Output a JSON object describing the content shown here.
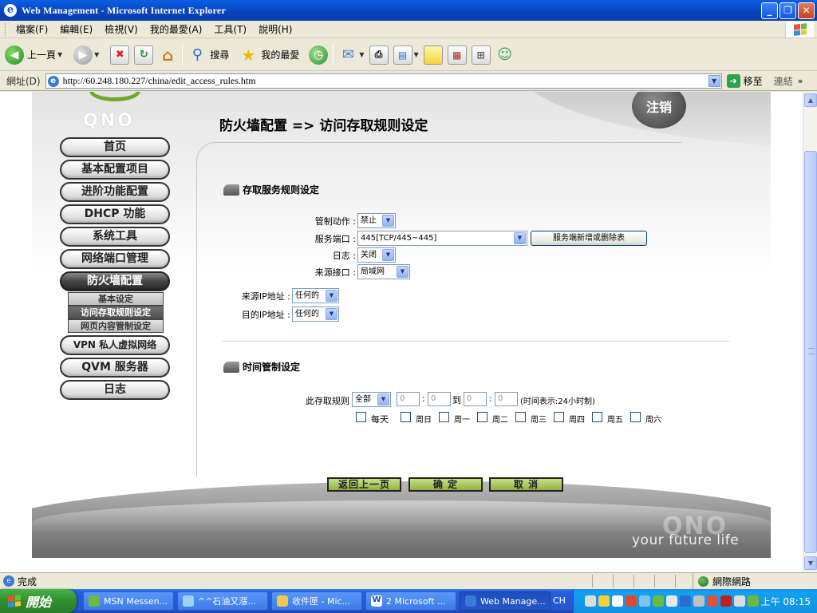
{
  "window": {
    "title": "Web Management - Microsoft Internet Explorer",
    "min_label": "_",
    "max_label": "❐",
    "close_label": "✕"
  },
  "menubar": {
    "items": [
      "檔案(F)",
      "編輯(E)",
      "檢視(V)",
      "我的最愛(A)",
      "工具(T)",
      "說明(H)"
    ]
  },
  "toolbar": {
    "back_label": "上一頁",
    "search_label": "搜尋",
    "favorites_label": "我的最愛"
  },
  "addressbar": {
    "label": "網址(D)",
    "url": "http://60.248.180.227/china/edit_access_rules.htm",
    "go_label": "移至",
    "links_label": "連結"
  },
  "page": {
    "logo": "QNO",
    "logout": "注销",
    "title": "防火墙配置 => 访问存取规则设定",
    "footer_brand": "your future life",
    "footer_logo": "QNO"
  },
  "nav": {
    "items": [
      "首页",
      "基本配置项目",
      "进阶功能配置",
      "DHCP 功能",
      "系统工具",
      "网络端口管理",
      "防火墙配置",
      "VPN 私人虚拟网络",
      "QVM 服务器",
      "日志"
    ],
    "active_index": 6,
    "sub_items": [
      "基本设定",
      "访问存取规则设定",
      "网页内容管制设定"
    ],
    "sub_active_index": 1
  },
  "access_section": {
    "title": "存取服务规则设定",
    "action_label": "管制动作 :",
    "action_value": "禁止",
    "service_label": "服务端口 :",
    "service_value": "445[TCP/445~445]",
    "service_button": "服务端新增或删除表",
    "log_label": "日志 :",
    "log_value": "关闭",
    "source_if_label": "来源接口 :",
    "source_if_value": "局域网",
    "source_ip_label": "来源IP地址 :",
    "source_ip_value": "任何的",
    "dest_ip_label": "目的IP地址 :",
    "dest_ip_value": "任何的"
  },
  "time_section": {
    "title": "时间管制设定",
    "rule_label": "此存取规则",
    "rule_value": "全部",
    "start_hour": "0",
    "start_min": "0",
    "to_label": "到",
    "end_hour": "0",
    "end_min": "0",
    "colon": ":",
    "hint": "(时间表示:24小时制)",
    "days": [
      "每天",
      "周日",
      "周一",
      "周二",
      "周三",
      "周四",
      "周五",
      "周六"
    ]
  },
  "actions": {
    "back": "返回上一页",
    "ok": "确 定",
    "cancel": "取 消"
  },
  "statusbar": {
    "status": "完成",
    "zone": "網際網路"
  },
  "taskbar": {
    "start": "開始",
    "tasks": [
      "MSN Messen...",
      "^^石油又漲...",
      "收件匣 - Mic...",
      "2 Microsoft ...",
      "Web Manage..."
    ],
    "active_task_index": 4,
    "lang": "CH",
    "clock": "上午 08:15"
  }
}
